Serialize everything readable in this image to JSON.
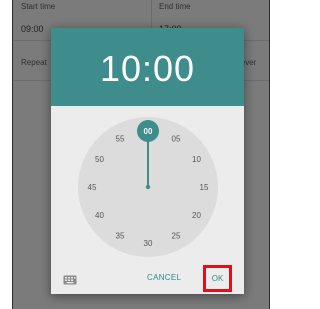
{
  "background": {
    "start_label": "Start time",
    "start_time": "09:00",
    "end_label": "End time",
    "end_time": "17:00",
    "repeat_label": "Repeat",
    "repeat_value": "Never"
  },
  "dialog": {
    "time": "10:00",
    "clock_numbers": [
      "00",
      "05",
      "10",
      "15",
      "20",
      "25",
      "30",
      "35",
      "40",
      "45",
      "50",
      "55"
    ],
    "selected_minute": "00",
    "cancel_label": "CANCEL",
    "ok_label": "OK",
    "keyboard_icon": "keyboard-icon"
  },
  "colors": {
    "accent": "#3e8c8c",
    "button_text": "#2e8b8b",
    "highlight": "#e0101a",
    "clock_face": "#dcdcdc"
  }
}
